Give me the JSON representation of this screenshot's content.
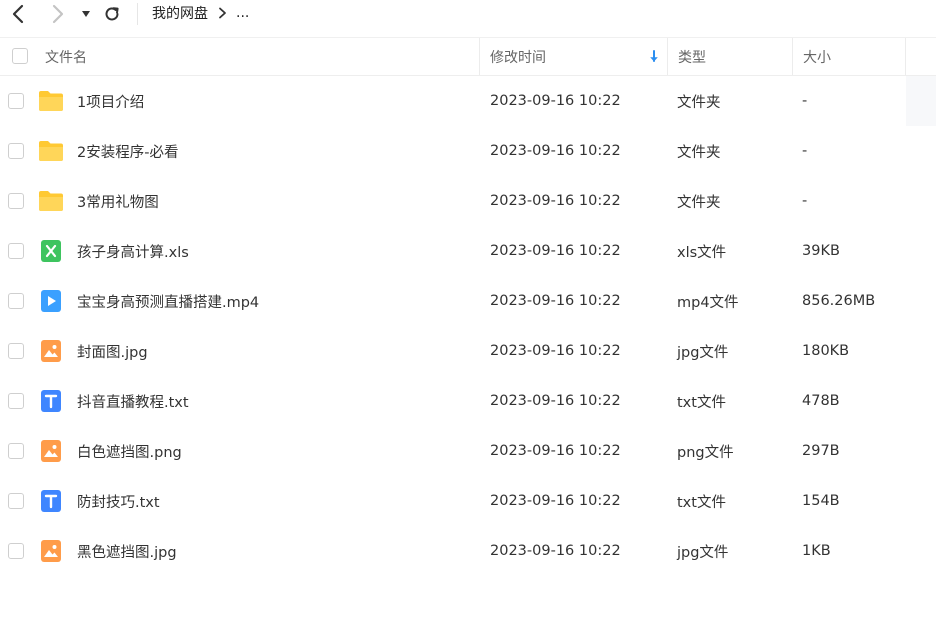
{
  "breadcrumb": {
    "root": "我的网盘",
    "more": "..."
  },
  "columns": {
    "name": "文件名",
    "time": "修改时间",
    "type": "类型",
    "size": "大小"
  },
  "icons": {
    "back": "chevron-left-icon",
    "forward": "chevron-right-icon",
    "dropdown": "caret-down-icon",
    "refresh": "refresh-icon",
    "sort": "arrow-down-icon",
    "folder": "folder-icon",
    "excel": "excel-file-icon",
    "video": "video-file-icon",
    "image": "image-file-icon",
    "text": "text-file-icon"
  },
  "colors": {
    "folder": "#ffc933",
    "excel": "#3ec45f",
    "video": "#3aa0ff",
    "image": "#ff9c4a",
    "text": "#3f86ff",
    "sort_arrow": "#2b8ef0"
  },
  "files": [
    {
      "name": "1项目介绍",
      "time": "2023-09-16 10:22",
      "type": "文件夹",
      "size": "-",
      "kind": "folder"
    },
    {
      "name": "2安装程序-必看",
      "time": "2023-09-16 10:22",
      "type": "文件夹",
      "size": "-",
      "kind": "folder"
    },
    {
      "name": "3常用礼物图",
      "time": "2023-09-16 10:22",
      "type": "文件夹",
      "size": "-",
      "kind": "folder"
    },
    {
      "name": "孩子身高计算.xls",
      "time": "2023-09-16 10:22",
      "type": "xls文件",
      "size": "39KB",
      "kind": "excel"
    },
    {
      "name": "宝宝身高预测直播搭建.mp4",
      "time": "2023-09-16 10:22",
      "type": "mp4文件",
      "size": "856.26MB",
      "kind": "video"
    },
    {
      "name": "封面图.jpg",
      "time": "2023-09-16 10:22",
      "type": "jpg文件",
      "size": "180KB",
      "kind": "image"
    },
    {
      "name": "抖音直播教程.txt",
      "time": "2023-09-16 10:22",
      "type": "txt文件",
      "size": "478B",
      "kind": "text"
    },
    {
      "name": "白色遮挡图.png",
      "time": "2023-09-16 10:22",
      "type": "png文件",
      "size": "297B",
      "kind": "image"
    },
    {
      "name": "防封技巧.txt",
      "time": "2023-09-16 10:22",
      "type": "txt文件",
      "size": "154B",
      "kind": "text"
    },
    {
      "name": "黑色遮挡图.jpg",
      "time": "2023-09-16 10:22",
      "type": "jpg文件",
      "size": "1KB",
      "kind": "image"
    }
  ]
}
